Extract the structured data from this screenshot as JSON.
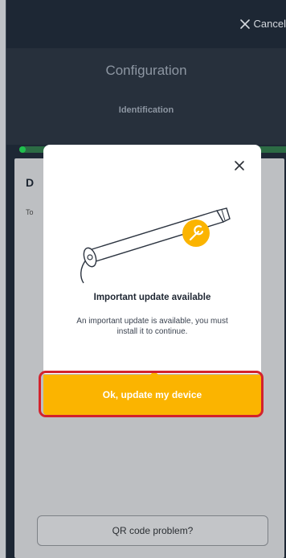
{
  "topbar": {
    "cancel_label": "Cancel"
  },
  "header": {
    "title": "Configuration",
    "subtitle": "Identification"
  },
  "progress": {
    "fraction": 0.03,
    "color": "#1fbf4d"
  },
  "content": {
    "title_partial": "D",
    "text_partial": "To"
  },
  "modal": {
    "heading": "Important update available",
    "body": "An important update is available, you must install it to continue.",
    "cta_label": "Ok, update my device",
    "illustration_icon": "wrench-icon"
  },
  "footer": {
    "qr_label": "QR code problem?"
  },
  "colors": {
    "accent": "#fbb400",
    "highlight": "#d3222d"
  }
}
